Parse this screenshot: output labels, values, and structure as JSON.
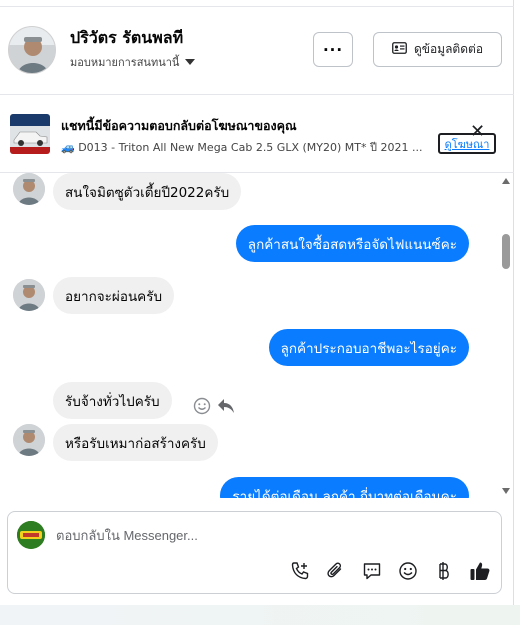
{
  "header": {
    "user_name": "ปริวัตร รัตนพลที",
    "assign_label": "มอบหมายการสนทนานี้",
    "more_label": "···",
    "contact_label": "ดูข้อมูลติดต่อ"
  },
  "ad": {
    "thumb_text": "TRITON",
    "title": "แชทนี้มีข้อความตอบกลับต่อโฆษณาของคุณ",
    "subtitle": "🚙 D013 - Triton All New Mega Cab 2.5 GLX (MY20) MT* ปี 2021 ...",
    "link_label": "ดูโฆษณา",
    "close_glyph": "✕"
  },
  "messages": [
    {
      "dir": "in",
      "text": "สนใจมิตซูตัวเตี้ยปี2022ครับ"
    },
    {
      "dir": "out",
      "text": "ลูกค้าสนใจซื้อสดหรือจัดไฟแนนซ์คะ"
    },
    {
      "dir": "in",
      "text": "อยากจะผ่อนครับ"
    },
    {
      "dir": "out",
      "text": "ลูกค้าประกอบอาชีพอะไรอยู่คะ"
    },
    {
      "dir": "in",
      "text": "รับจ้างทั่วไปครับ"
    },
    {
      "dir": "in",
      "text": "หรือรับเหมาก่อสร้างครับ"
    },
    {
      "dir": "out",
      "text": "รายได้ต่อเดือน ลูกค้า กี่บาทต่อเดือนคะ"
    }
  ],
  "composer": {
    "placeholder": "ตอบกลับใน Messenger...",
    "tools": [
      "call-add-icon",
      "paperclip-icon",
      "saved-reply-icon",
      "emoji-icon",
      "baht-icon",
      "thumbs-up-icon"
    ]
  },
  "colors": {
    "accent": "#0a7cff",
    "bubble_in": "#f0f0f0"
  }
}
